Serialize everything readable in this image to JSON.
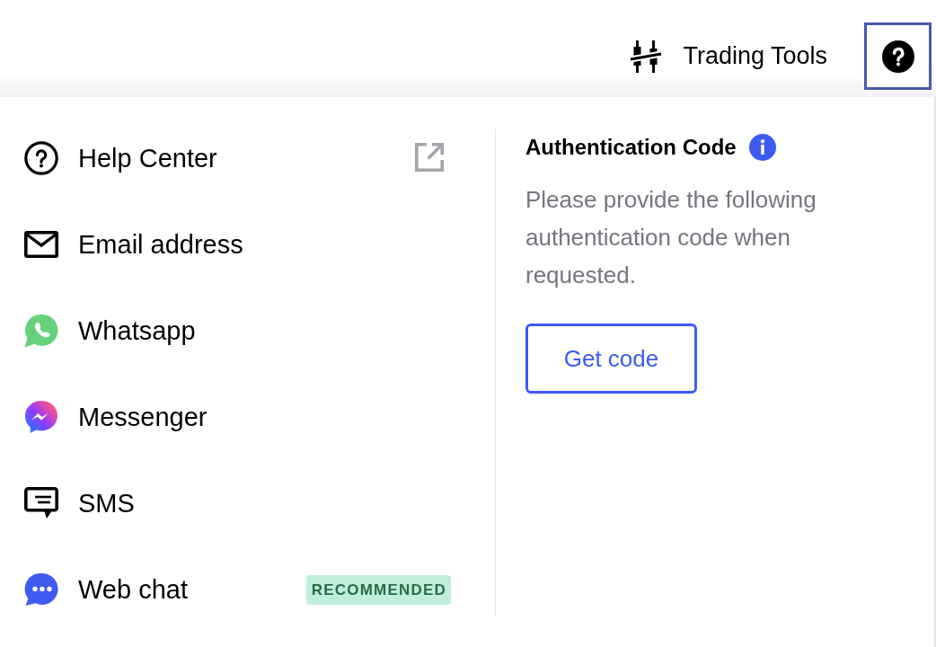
{
  "header": {
    "trading_tools": {
      "label": "Trading Tools"
    },
    "help_button": {
      "focused": true
    }
  },
  "contact_menu": {
    "items": [
      {
        "label": "Help Center",
        "external_link": true
      },
      {
        "label": "Email address",
        "external_link": false
      },
      {
        "label": "Whatsapp",
        "external_link": false
      },
      {
        "label": "Messenger",
        "external_link": false
      },
      {
        "label": "SMS",
        "external_link": false
      },
      {
        "label": "Web chat",
        "external_link": false,
        "tag": "RECOMMENDED"
      }
    ]
  },
  "authentication": {
    "title": "Authentication Code",
    "description": "Please provide the following authentication code when requested.",
    "button": "Get code"
  }
}
